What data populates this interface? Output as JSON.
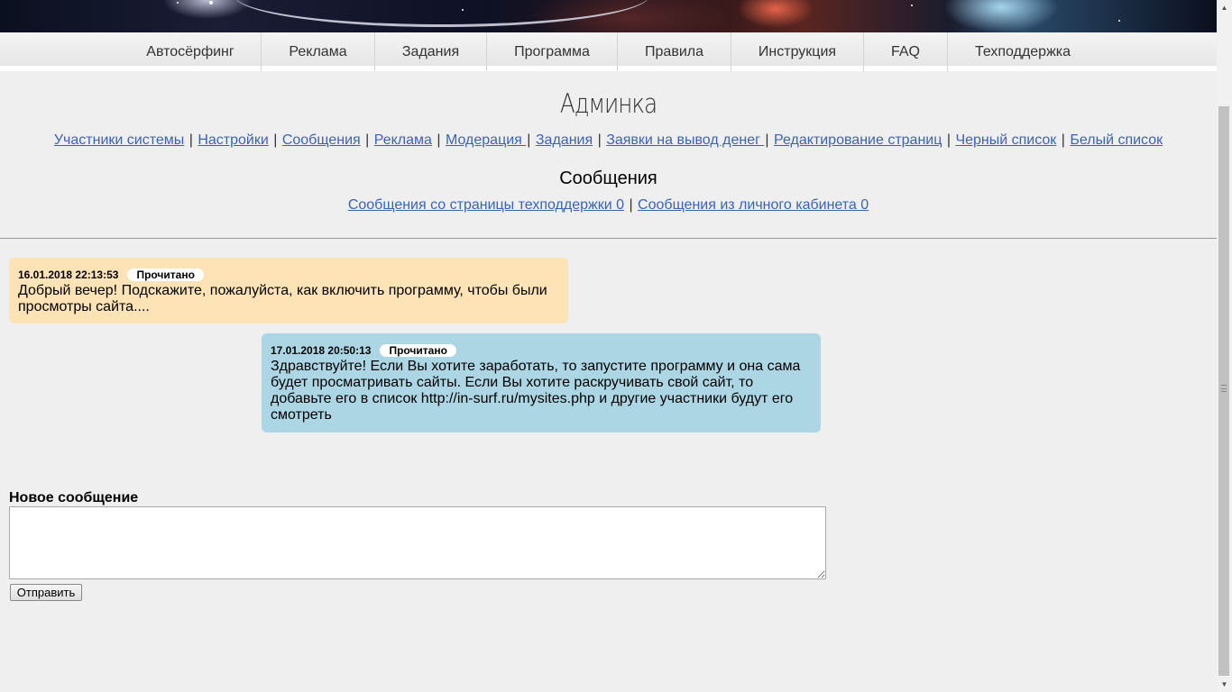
{
  "nav": {
    "items": [
      {
        "label": "Автосёрфинг"
      },
      {
        "label": "Реклама"
      },
      {
        "label": "Задания"
      },
      {
        "label": "Программа"
      },
      {
        "label": "Правила"
      },
      {
        "label": "Инструкция"
      },
      {
        "label": "FAQ"
      },
      {
        "label": "Техподдержка"
      }
    ]
  },
  "page": {
    "title": "Админка"
  },
  "admin_links": [
    {
      "label": "Участники системы"
    },
    {
      "label": "Настройки"
    },
    {
      "label": "Сообщения"
    },
    {
      "label": "Реклама"
    },
    {
      "label": "Модерация "
    },
    {
      "label": "Задания"
    },
    {
      "label": "Заявки на вывод денег "
    },
    {
      "label": "Редактирование страниц"
    },
    {
      "label": "Черный список"
    },
    {
      "label": "Белый список"
    }
  ],
  "separator": "|",
  "messages_section": {
    "title": "Сообщения",
    "support_link": "Сообщения со страницы техподдержки 0",
    "cabinet_link": "Сообщения из личного кабинета 0"
  },
  "messages": [
    {
      "timestamp": "16.01.2018 22:13:53",
      "status": "Прочитано",
      "text": "Добрый вечер! Подскажите, пожалуйста, как включить программу, чтобы были просмотры сайта....",
      "color": "#fde3b6"
    },
    {
      "timestamp": "17.01.2018 20:50:13",
      "status": "Прочитано",
      "text": "Здравствуйте! Если Вы хотите заработать, то запустите программу и она сама будет просматривать сайты. Если Вы хотите раскручивать свой сайт, то добавьте его в список http://in-surf.ru/mysites.php и другие участники будут его смотреть",
      "color": "#acd6e4"
    }
  ],
  "new_message": {
    "label": "Новое сообщение",
    "value": "",
    "send_label": "Отправить"
  },
  "colors": {
    "link": "#3a63b8",
    "background": "#efefef"
  }
}
